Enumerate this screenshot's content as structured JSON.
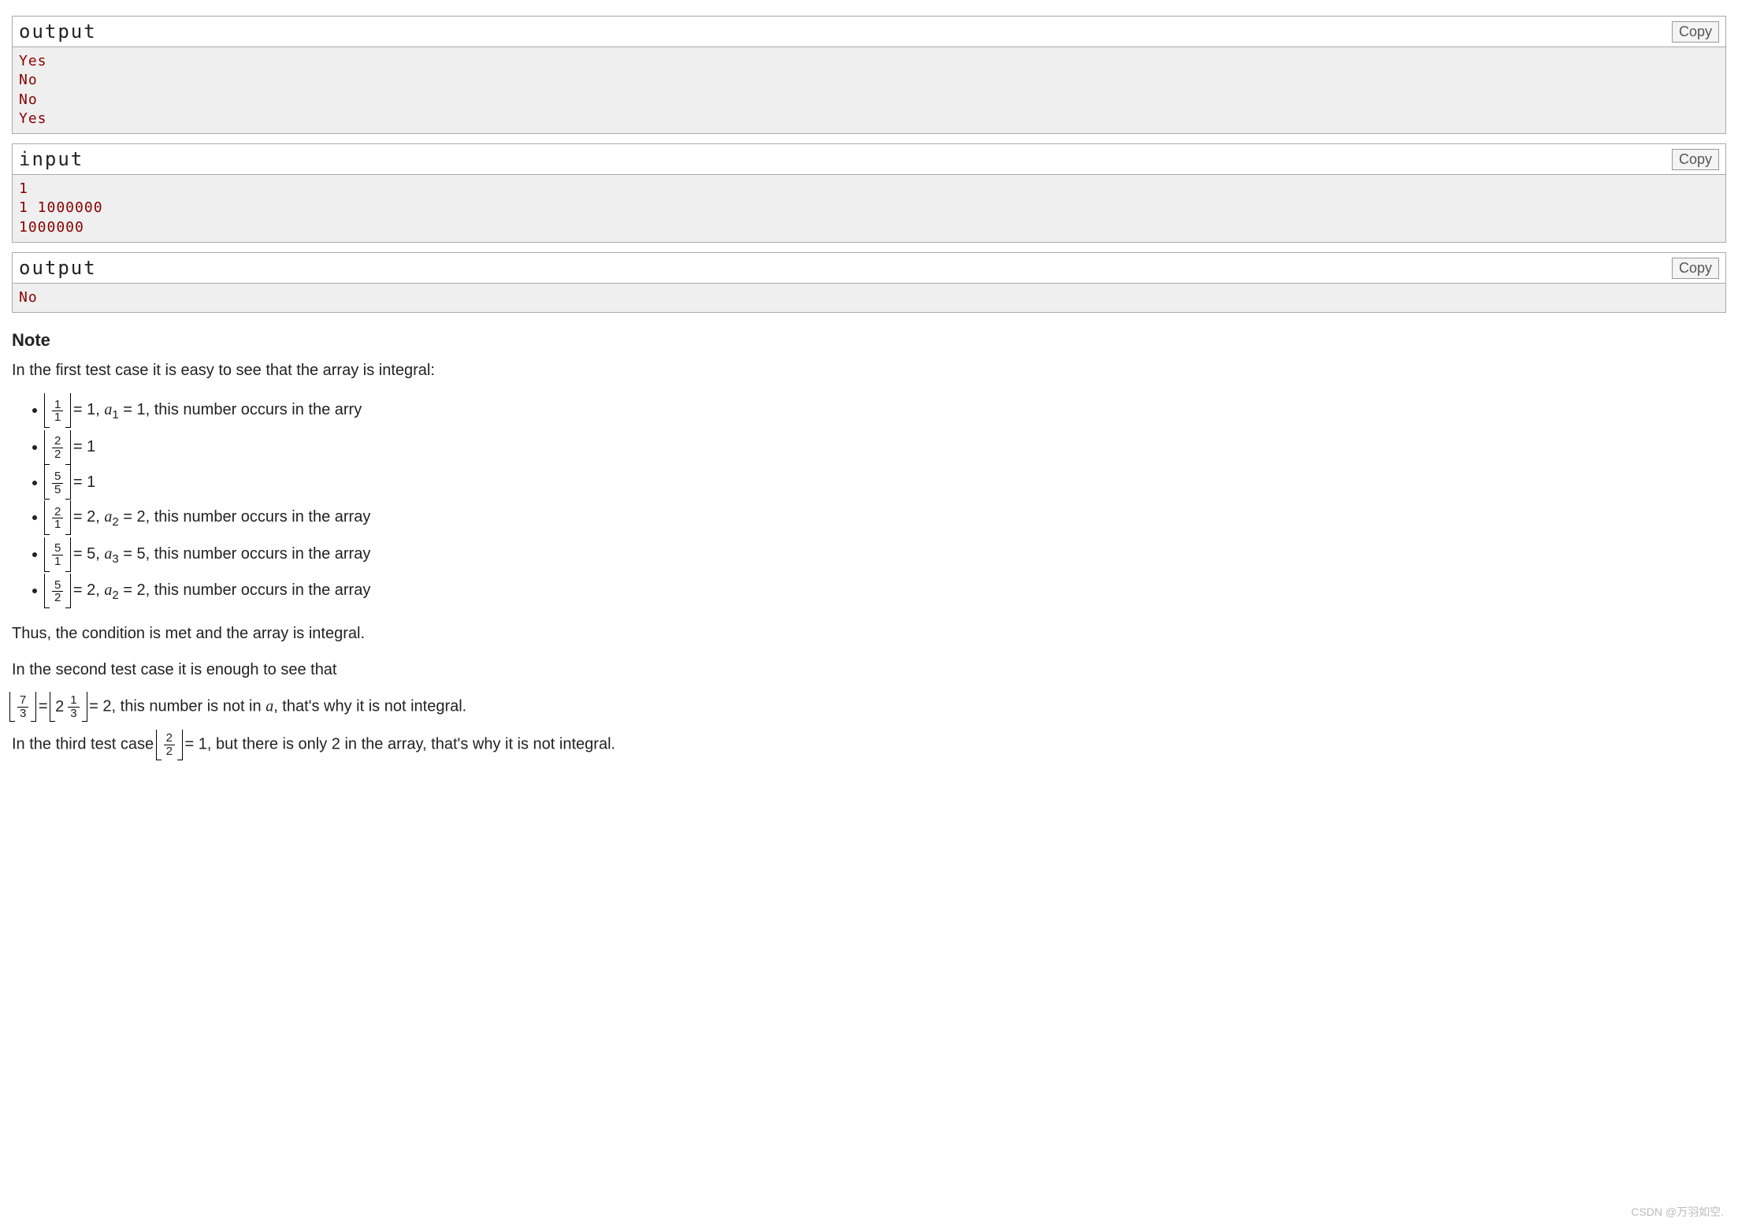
{
  "copy_label": "Copy",
  "blocks": [
    {
      "header": "output",
      "content": "Yes\nNo\nNo\nYes"
    },
    {
      "header": "input",
      "content": "1\n1 1000000\n1000000"
    },
    {
      "header": "output",
      "content": "No"
    }
  ],
  "note": {
    "title": "Note",
    "intro": "In the first test case it is easy to see that the array is integral:",
    "items": [
      {
        "num": "1",
        "den": "1",
        "eq": " = 1, ",
        "ai": "a",
        "aisub": "1",
        "aival": " = 1",
        "tail": ", this number occurs in the arry"
      },
      {
        "num": "2",
        "den": "2",
        "eq": " = 1",
        "ai": "",
        "aisub": "",
        "aival": "",
        "tail": ""
      },
      {
        "num": "5",
        "den": "5",
        "eq": " = 1",
        "ai": "",
        "aisub": "",
        "aival": "",
        "tail": ""
      },
      {
        "num": "2",
        "den": "1",
        "eq": " = 2, ",
        "ai": "a",
        "aisub": "2",
        "aival": " = 2",
        "tail": ", this number occurs in the array"
      },
      {
        "num": "5",
        "den": "1",
        "eq": " = 5, ",
        "ai": "a",
        "aisub": "3",
        "aival": " = 5",
        "tail": ", this number occurs in the array"
      },
      {
        "num": "5",
        "den": "2",
        "eq": " = 2, ",
        "ai": "a",
        "aisub": "2",
        "aival": " = 2",
        "tail": ", this number occurs in the array"
      }
    ],
    "thus": "Thus, the condition is met and the array is integral.",
    "second_intro": "In the second test case it is enough to see that",
    "second_frac_num": "7",
    "second_frac_den": "3",
    "second_mixed_int": "2",
    "second_mixed_num": "1",
    "second_mixed_den": "3",
    "second_eq_val": " = 2",
    "second_tail": ", this number is not in ",
    "second_var": "a",
    "second_tail2": ", that's why it is not integral.",
    "third_intro": "In the third test case ",
    "third_frac_num": "2",
    "third_frac_den": "2",
    "third_eq": " = 1",
    "third_tail": ", but there is only 2 in the array, that's why it is not integral."
  },
  "watermark": "CSDN @万羽如空."
}
